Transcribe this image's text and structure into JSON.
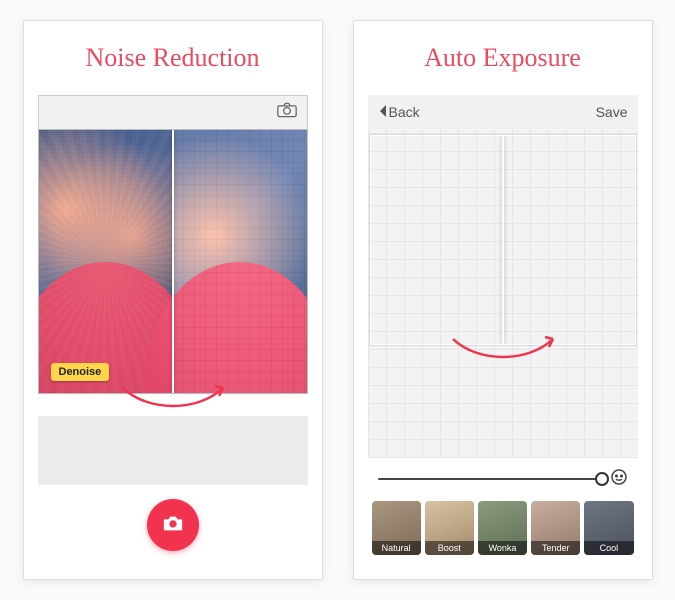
{
  "left": {
    "title": "Noise Reduction",
    "badge": "Denoise"
  },
  "right": {
    "title": "Auto Exposure",
    "nav": {
      "back": "Back",
      "save": "Save"
    },
    "filters": [
      {
        "name": "Natural",
        "swatch": "f-natural",
        "selected": false
      },
      {
        "name": "Boost",
        "swatch": "f-boost",
        "selected": true
      },
      {
        "name": "Wonka",
        "swatch": "f-wonka",
        "selected": false
      },
      {
        "name": "Tender",
        "swatch": "f-tender",
        "selected": false
      },
      {
        "name": "Cool",
        "swatch": "f-cool",
        "selected": false
      }
    ]
  },
  "colors": {
    "accent": "#f2334f",
    "title": "#ec4b5f",
    "badge": "#ffd64a"
  }
}
